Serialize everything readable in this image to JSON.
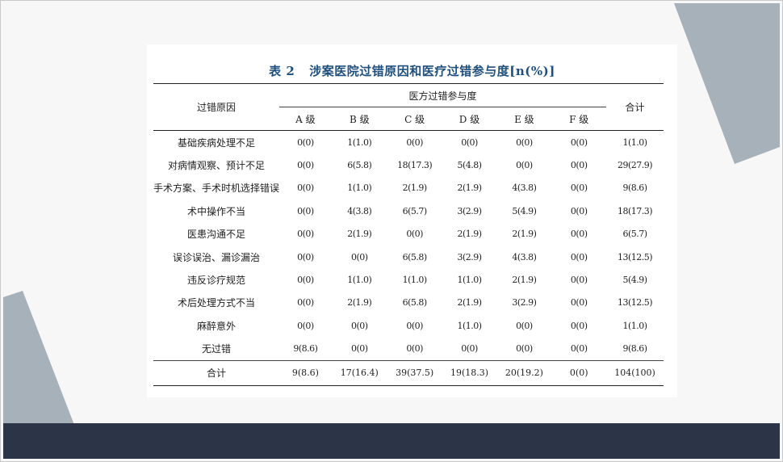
{
  "table": {
    "title_number": "表 2",
    "title_text": "涉案医院过错原因和医疗过错参与度[n(%)]",
    "col_cause": "过错原因",
    "col_group": "医方过错参与度",
    "col_total": "合计",
    "grades": [
      "A 级",
      "B 级",
      "C 级",
      "D 级",
      "E 级",
      "F 级"
    ],
    "rows": [
      {
        "cause": "基础疾病处理不足",
        "values": [
          "0(0)",
          "1(1.0)",
          "0(0)",
          "0(0)",
          "0(0)",
          "0(0)",
          "1(1.0)"
        ]
      },
      {
        "cause": "对病情观察、预计不足",
        "values": [
          "0(0)",
          "6(5.8)",
          "18(17.3)",
          "5(4.8)",
          "0(0)",
          "0(0)",
          "29(27.9)"
        ]
      },
      {
        "cause": "手术方案、手术时机选择错误",
        "values": [
          "0(0)",
          "1(1.0)",
          "2(1.9)",
          "2(1.9)",
          "4(3.8)",
          "0(0)",
          "9(8.6)"
        ]
      },
      {
        "cause": "术中操作不当",
        "values": [
          "0(0)",
          "4(3.8)",
          "6(5.7)",
          "3(2.9)",
          "5(4.9)",
          "0(0)",
          "18(17.3)"
        ]
      },
      {
        "cause": "医患沟通不足",
        "values": [
          "0(0)",
          "2(1.9)",
          "0(0)",
          "2(1.9)",
          "2(1.9)",
          "0(0)",
          "6(5.7)"
        ]
      },
      {
        "cause": "误诊误治、漏诊漏治",
        "values": [
          "0(0)",
          "0(0)",
          "6(5.8)",
          "3(2.9)",
          "4(3.8)",
          "0(0)",
          "13(12.5)"
        ]
      },
      {
        "cause": "违反诊疗规范",
        "values": [
          "0(0)",
          "1(1.0)",
          "1(1.0)",
          "1(1.0)",
          "2(1.9)",
          "0(0)",
          "5(4.9)"
        ]
      },
      {
        "cause": "术后处理方式不当",
        "values": [
          "0(0)",
          "2(1.9)",
          "6(5.8)",
          "2(1.9)",
          "3(2.9)",
          "0(0)",
          "13(12.5)"
        ]
      },
      {
        "cause": "麻醉意外",
        "values": [
          "0(0)",
          "0(0)",
          "0(0)",
          "1(1.0)",
          "0(0)",
          "0(0)",
          "1(1.0)"
        ]
      },
      {
        "cause": "无过错",
        "values": [
          "9(8.6)",
          "0(0)",
          "0(0)",
          "0(0)",
          "0(0)",
          "0(0)",
          "9(8.6)"
        ]
      }
    ],
    "total_row": {
      "cause": "合计",
      "values": [
        "9(8.6)",
        "17(16.4)",
        "39(37.5)",
        "19(18.3)",
        "20(19.2)",
        "0(0)",
        "104(100)"
      ]
    }
  },
  "colors": {
    "title": "#1f4f7a",
    "shape_gray": "#a7b1ba",
    "footer_navy": "#2c3548",
    "background": "#f7f7f7"
  }
}
